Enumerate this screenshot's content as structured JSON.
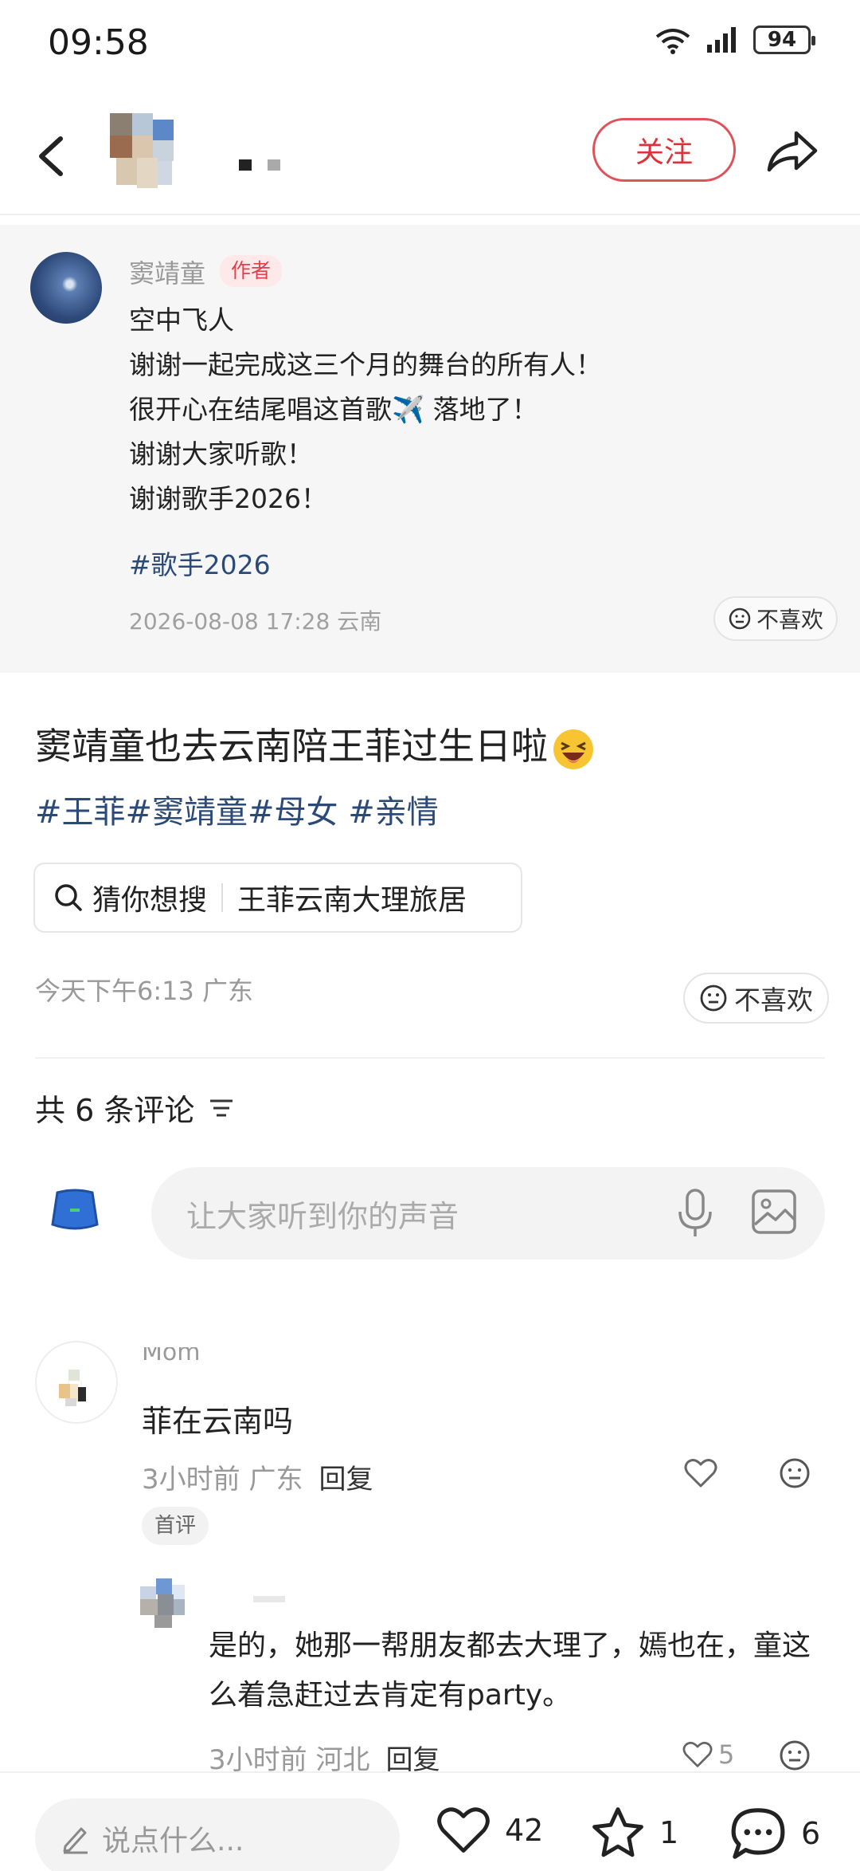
{
  "status_bar": {
    "time": "09:58",
    "battery": "94"
  },
  "header": {
    "follow_label": "关注"
  },
  "quoted_post": {
    "author": "窦靖童",
    "author_badge": "作者",
    "lines": [
      "空中飞人",
      "谢谢一起完成这三个月的舞台的所有人！",
      "很开心在结尾唱这首歌✈️ 落地了！",
      "谢谢大家听歌！",
      "谢谢歌手2026！"
    ],
    "hashtag": "#歌手2026",
    "meta": "2026-08-08 17:28  云南",
    "dislike_label": "不喜欢"
  },
  "post": {
    "title": "窦靖童也去云南陪王菲过生日啦",
    "tags": "#王菲#窦靖童#母女 #亲情",
    "search_label": "猜你想搜",
    "search_query": "王菲云南大理旅居",
    "meta": "今天下午6:13  广东",
    "dislike_label": "不喜欢"
  },
  "comments_header": {
    "count_label": "共 6 条评论"
  },
  "comment_input": {
    "placeholder": "让大家听到你的声音"
  },
  "comments": [
    {
      "name": "Mom",
      "text": "菲在云南吗",
      "meta": "3小时前  广东",
      "reply_label": "回复",
      "badge": "首评"
    }
  ],
  "reply": {
    "text": "是的，她那一帮朋友都去大理了，嫣也在，童这么着急赶过去肯定有party。",
    "meta": "3小时前  河北",
    "reply_label": "回复",
    "likes": "5"
  },
  "bottom_bar": {
    "input_placeholder": "说点什么...",
    "likes": "42",
    "favorites": "1",
    "comments": "6"
  },
  "colors": {
    "accent_red": "#e0303a",
    "hashtag_blue": "#2b4a78"
  },
  "icons": [
    "back-icon",
    "share-icon",
    "wifi-icon",
    "signal-icon",
    "search-icon",
    "sort-icon",
    "mic-icon",
    "image-icon",
    "heart-icon",
    "face-icon",
    "star-icon",
    "comment-icon",
    "pencil-icon"
  ]
}
